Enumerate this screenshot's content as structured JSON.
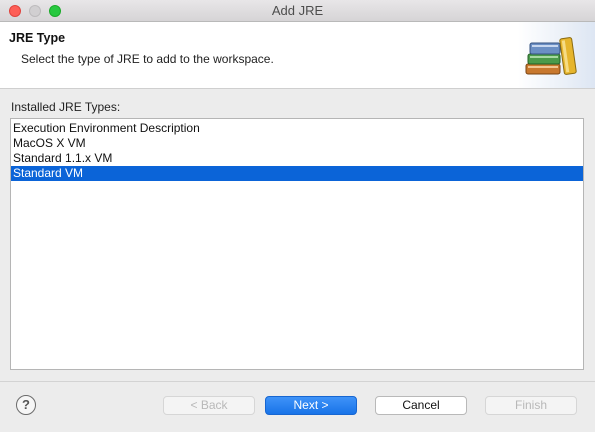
{
  "window": {
    "title": "Add JRE"
  },
  "header": {
    "title": "JRE Type",
    "description": "Select the type of JRE to add to the workspace."
  },
  "jre_types": {
    "label": "Installed JRE Types:",
    "items": [
      {
        "label": "Execution Environment Description",
        "selected": false
      },
      {
        "label": "MacOS X VM",
        "selected": false
      },
      {
        "label": "Standard 1.1.x VM",
        "selected": false
      },
      {
        "label": "Standard VM",
        "selected": true
      }
    ]
  },
  "footer": {
    "help_icon": "help-icon",
    "help_glyph": "?",
    "back_label": "< Back",
    "next_label": "Next >",
    "cancel_label": "Cancel",
    "finish_label": "Finish"
  },
  "colors": {
    "selection": "#0b64d8",
    "default_button": "#1873e8",
    "close": "#fe5f57",
    "zoom": "#28c840"
  }
}
